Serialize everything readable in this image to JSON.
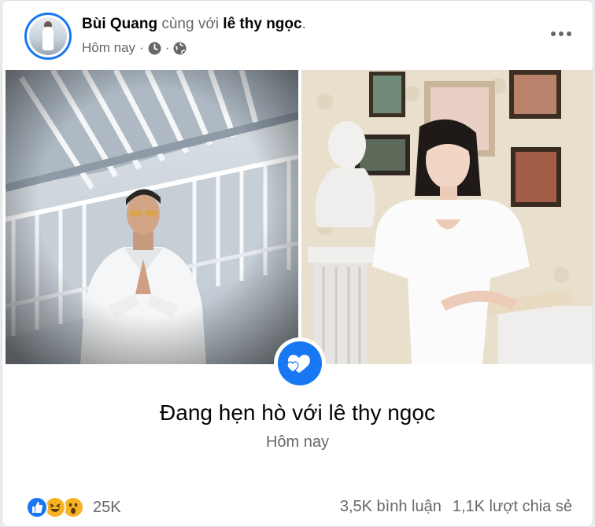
{
  "post": {
    "author": "Bùi Quang",
    "with_text": "cùng với",
    "tagged": "lê thy ngọc",
    "period": ".",
    "time": "Hôm nay",
    "separator": "·",
    "time_icon": "clock-icon",
    "audience_icon": "globe-icon"
  },
  "life_event": {
    "icon": "heart-icon",
    "title": "Đang hẹn hò với lê thy ngọc",
    "time": "Hôm nay"
  },
  "footer": {
    "reactions": [
      "like-reaction-icon",
      "haha-reaction-icon",
      "wow-reaction-icon"
    ],
    "reaction_count": "25K",
    "comments": "3,5K bình luận",
    "shares": "1,1K lượt chia sẻ"
  },
  "colors": {
    "accent": "#1877f2",
    "text_primary": "#050505",
    "text_secondary": "#65676b"
  }
}
